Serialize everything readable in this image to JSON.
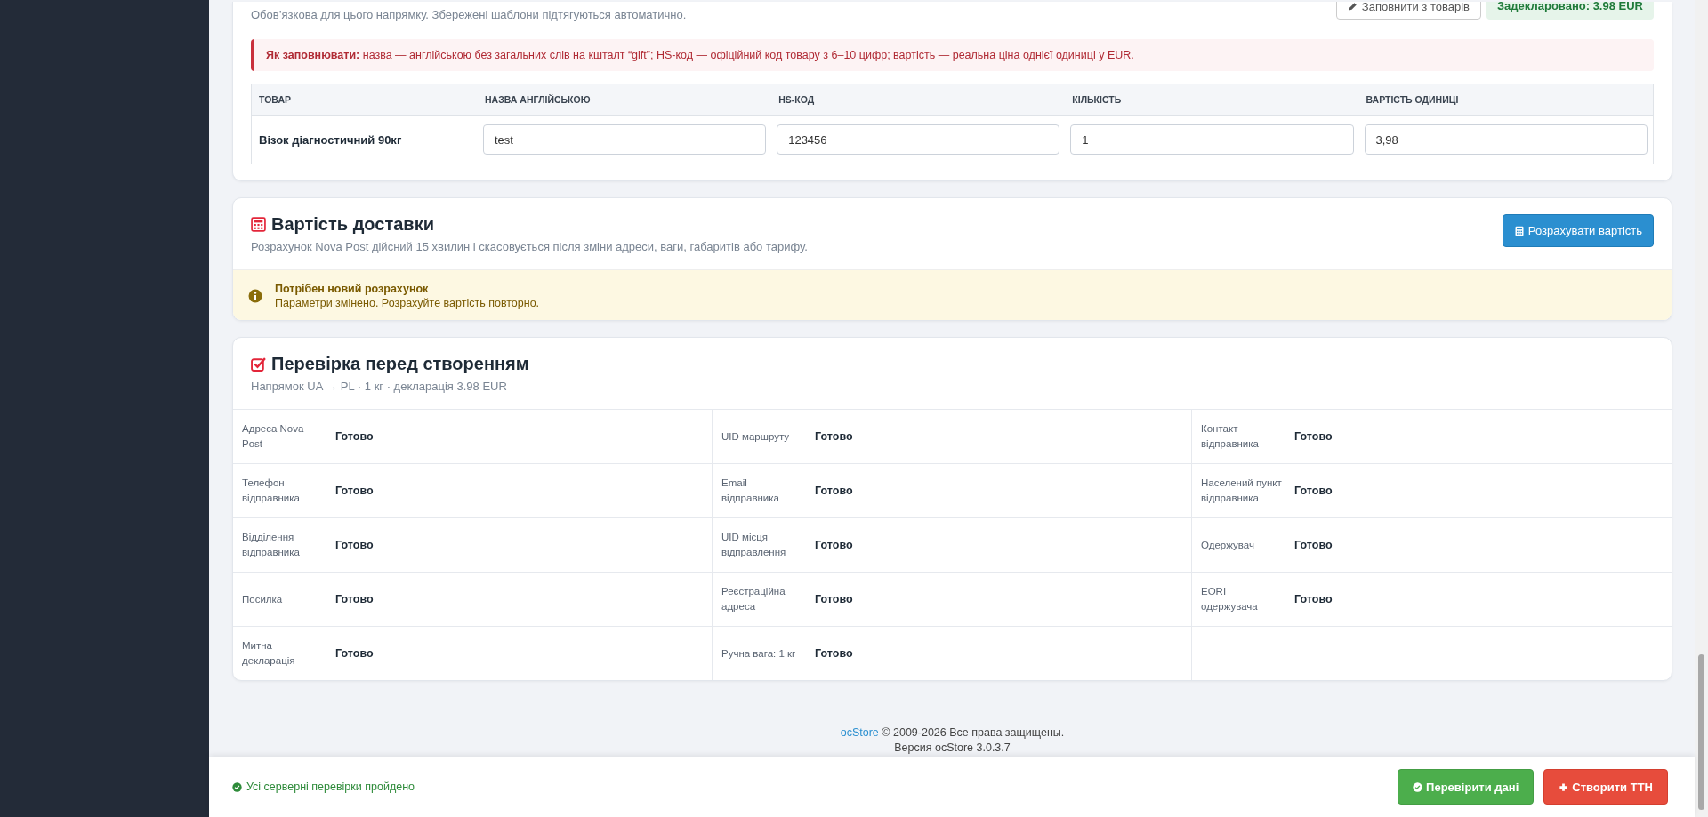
{
  "customs": {
    "subtitle": "Обов’язкова для цього напрямку. Збережені шаблони підтягуються автоматично.",
    "fill_button": "Заповнити з товарів",
    "declared": "Задекларовано: 3.98 EUR",
    "hint": "**Як заповнювати:** назва — англійською без загальних слів на кшталт “gift”; HS-код — офіційний код товару з 6–10 цифр; вартість — реальна ціна однієї одиниці у EUR.",
    "columns": [
      "ТОВАР",
      "НАЗВА АНГЛІЙСЬКОЮ",
      "HS-КОД",
      "КІЛЬКІСТЬ",
      "ВАРТІСТЬ ОДИНИЦІ"
    ],
    "rows": [
      {
        "product": "Візок діагностичний 90кг",
        "name_en": "test",
        "hs_code": "123456",
        "quantity": "1",
        "unit_value": "3,98"
      }
    ]
  },
  "delivery": {
    "title": "Вартість доставки",
    "subtitle": "Розрахунок Nova Post дійсний 15 хвилин і скасовується після зміни адреси, ваги, габаритів або тарифу.",
    "button": "Розрахувати вартість",
    "notice": {
      "title": "Потрібен новий розрахунок",
      "text": "Параметри змінено. Розрахуйте вартість повторно."
    }
  },
  "verification": {
    "title": "Перевірка перед створенням",
    "subtitle": "Напрямок UA → PL · 1 кг · декларація 3.98 EUR",
    "items": [
      {
        "label": "Адреса Nova Post",
        "value": "Готово"
      },
      {
        "label": "UID маршруту",
        "value": "Готово"
      },
      {
        "label": "Контакт відправника",
        "value": "Готово"
      },
      {
        "label": "Телефон відправника",
        "value": "Готово"
      },
      {
        "label": "Email відправника",
        "value": "Готово"
      },
      {
        "label": "Населений пункт відправника",
        "value": "Готово"
      },
      {
        "label": "Відділення відправника",
        "value": "Готово"
      },
      {
        "label": "UID місця відправлення",
        "value": "Готово"
      },
      {
        "label": "Одержувач",
        "value": "Готово"
      },
      {
        "label": "Посилка",
        "value": "Готово"
      },
      {
        "label": "Реєстраційна адреса",
        "value": "Готово"
      },
      {
        "label": "EORI одержувача",
        "value": "Готово"
      },
      {
        "label": "Митна декларація",
        "value": "Готово"
      },
      {
        "label": "Ручна вага: 1 кг",
        "value": "Готово"
      }
    ]
  },
  "footer": {
    "brand": "ocStore",
    "copyright": "© 2009-2026 Все права защищены.",
    "version": "Версия ocStore 3.0.3.7"
  },
  "bottom_bar": {
    "status": "Усі серверні перевірки пройдено",
    "buttons": [
      {
        "label": "Перевірити дані",
        "kind": "check"
      },
      {
        "label": "Створити ТТН",
        "kind": "create"
      }
    ]
  }
}
